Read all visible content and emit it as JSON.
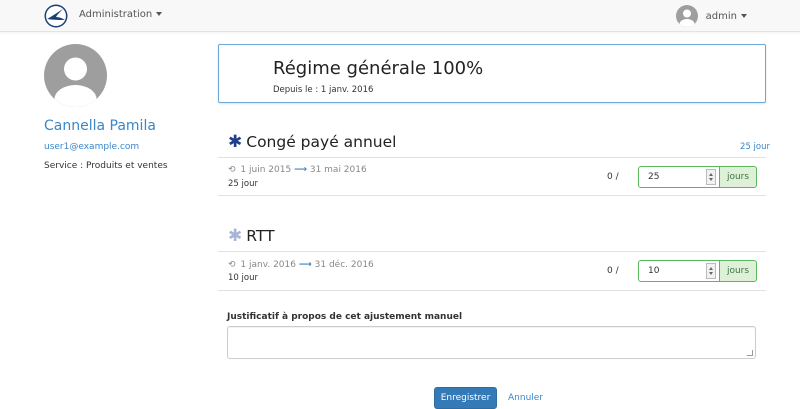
{
  "navbar": {
    "admin_menu_label": "Administration",
    "user_label": "admin"
  },
  "profile": {
    "name": "Cannella Pamila",
    "email": "user1@example.com",
    "service": "Service : Produits et ventes"
  },
  "regime": {
    "title": "Régime générale 100%",
    "since": "Depuis le : 1 janv. 2016"
  },
  "sections": [
    {
      "title": "Congé payé annuel",
      "total": "25 jour",
      "period_start": "1 juin 2015",
      "period_end": "31 mai 2016",
      "days": "25 jour",
      "ratio": "0 /",
      "value": "25",
      "unit": "jours",
      "icon": "asterisk-icon",
      "icon_color": "#1f3d8a"
    },
    {
      "title": "RTT",
      "period_start": "1 janv. 2016",
      "period_end": "31 déc. 2016",
      "days": "10 jour",
      "ratio": "0 /",
      "value": "10",
      "unit": "jours",
      "icon": "asterisk-icon",
      "icon_color": "#a6b6d8"
    }
  ],
  "justification": {
    "label": "Justificatif à propos de cet ajustement manuel",
    "value": ""
  },
  "actions": {
    "save_label": "Enregistrer",
    "cancel_label": "Annuler"
  },
  "colors": {
    "primary": "#337ab7",
    "link": "#3a87c8",
    "success_border": "#5cb85c",
    "success_bg": "#dff0d8"
  }
}
